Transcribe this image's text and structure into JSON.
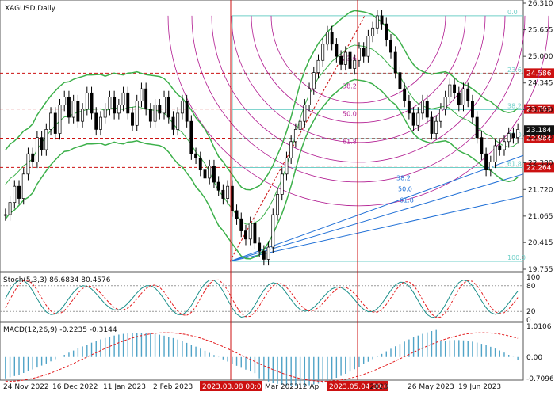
{
  "chart_data": {
    "type": "line",
    "symbol_title": "XAGUSD,Daily",
    "price_panel": {
      "y_ticks": [
        "26.310",
        "25.655",
        "25.000",
        "24.345",
        "23.690",
        "23.035",
        "22.380",
        "21.720",
        "21.065",
        "20.415",
        "19.755"
      ],
      "ylim": [
        19.755,
        26.31
      ],
      "last_price": "23.184",
      "levels": [
        {
          "value": "24.586",
          "color": "#cc1111"
        },
        {
          "value": "23.703",
          "color": "#cc1111"
        },
        {
          "value": "22.984",
          "color": "#cc1111"
        },
        {
          "value": "22.264",
          "color": "#cc1111"
        }
      ],
      "fib_retracement_labels": [
        "0.0",
        "23.6",
        "38.2",
        "50.0",
        "61.8",
        "100.0"
      ],
      "fan_labels": [
        "38.2",
        "50.0",
        "61.8"
      ],
      "arc_labels": [
        "23.6",
        "38.2",
        "50.0",
        "61.8"
      ],
      "series": [
        {
          "name": "price",
          "values": [
            21.1,
            21.4,
            21.8,
            21.5,
            22.1,
            22.6,
            22.4,
            23.0,
            22.7,
            23.2,
            23.6,
            23.1,
            23.8,
            24.0,
            23.5,
            23.9,
            23.4,
            23.7,
            24.1,
            23.6,
            23.2,
            23.5,
            23.7,
            24.0,
            23.6,
            23.8,
            24.1,
            23.6,
            23.3,
            23.9,
            24.2,
            23.7,
            23.4,
            23.8,
            23.6,
            24.0,
            23.5,
            23.2,
            23.6,
            23.9,
            23.4,
            22.6,
            22.5,
            22.2,
            22.0,
            22.3,
            21.9,
            21.7,
            21.5,
            21.8,
            21.2,
            21.0,
            20.7,
            20.5,
            20.9,
            20.4,
            20.2,
            20.0,
            20.3,
            21.1,
            21.6,
            22.1,
            22.5,
            22.9,
            23.2,
            23.4,
            23.8,
            24.2,
            24.6,
            24.9,
            25.3,
            25.6,
            25.3,
            25.0,
            24.8,
            25.1,
            24.7,
            24.9,
            25.2,
            25.0,
            25.5,
            25.7,
            26.0,
            25.8,
            25.4,
            25.1,
            24.6,
            24.2,
            23.9,
            23.6,
            23.3,
            23.6,
            23.9,
            23.5,
            23.1,
            23.4,
            23.7,
            24.0,
            24.3,
            24.1,
            23.8,
            24.2,
            23.9,
            23.5,
            23.0,
            22.6,
            22.2,
            22.4,
            22.8,
            22.7,
            22.9,
            23.1,
            23.0,
            23.2
          ]
        }
      ]
    },
    "stoch_panel": {
      "label": "Stoch(5,3,3) 86.6834 80.4576",
      "y_ticks": [
        "100",
        "80",
        "20",
        "0"
      ],
      "ylim": [
        0,
        100
      ]
    },
    "macd_panel": {
      "label": "MACD(12,26,9) -0.2235 -0.3144",
      "y_ticks": [
        "1.0106",
        "0.00",
        "-0.7096"
      ],
      "ylim": [
        -0.7096,
        1.0106
      ]
    },
    "x_ticks": [
      "24 Nov 2022",
      "16 Dec 2022",
      "11 Jan 2023",
      "2 Feb 2023",
      "Mar 2023",
      "12 Ap",
      "r 2023",
      "26 May 2023",
      "19 Jun 2023"
    ],
    "x_markers": [
      "2023.03.08 00:00",
      "2023.05.04 00:00"
    ],
    "colors": {
      "bollinger": "#3cb04a",
      "signal": "#e31a1c",
      "fib": "#6fcfc8",
      "arc": "#b0188f",
      "fan": "#1f6fd6",
      "level": "#cc1111",
      "marker": "#cc1111"
    }
  }
}
